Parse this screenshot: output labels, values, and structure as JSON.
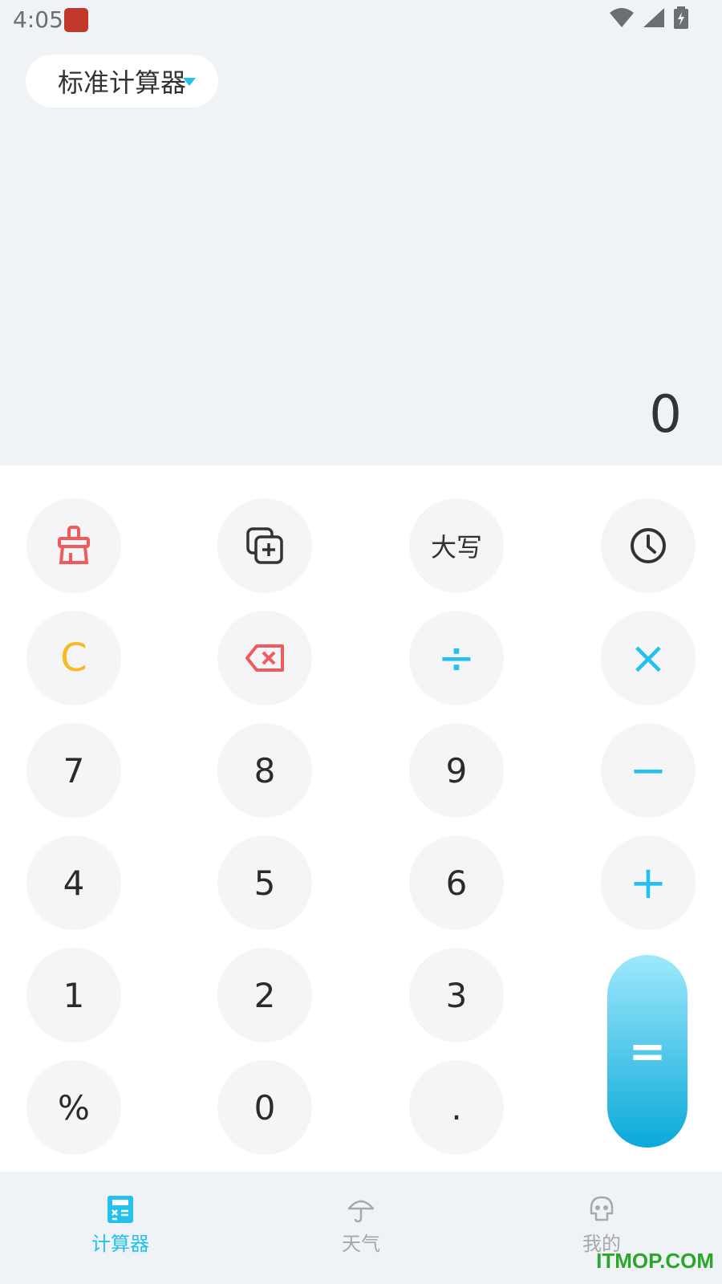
{
  "status_bar": {
    "time": "4:05"
  },
  "mode_selector": {
    "label": "标准计算器"
  },
  "display": {
    "value": "0"
  },
  "keys": {
    "clear_all": "clear-all",
    "copy": "copy",
    "uppercase": "大写",
    "history": "history",
    "clear": "C",
    "backspace": "backspace",
    "divide": "÷",
    "multiply": "×",
    "seven": "7",
    "eight": "8",
    "nine": "9",
    "minus": "−",
    "four": "4",
    "five": "5",
    "six": "6",
    "plus": "+",
    "one": "1",
    "two": "2",
    "three": "3",
    "percent": "%",
    "zero": "0",
    "dot": ".",
    "equals": "="
  },
  "bottom_nav": {
    "items": [
      {
        "label": "计算器",
        "icon": "calculator-icon",
        "active": true
      },
      {
        "label": "天气",
        "icon": "umbrella-icon",
        "active": false
      },
      {
        "label": "我的",
        "icon": "skull-icon",
        "active": false
      }
    ]
  },
  "watermark": "ITMOP.COM",
  "colors": {
    "accent": "#24c1ef",
    "clear": "#f7b924",
    "danger": "#f05a5a",
    "active_nav": "#24c1ef",
    "inactive_nav": "#a8a8a8"
  }
}
